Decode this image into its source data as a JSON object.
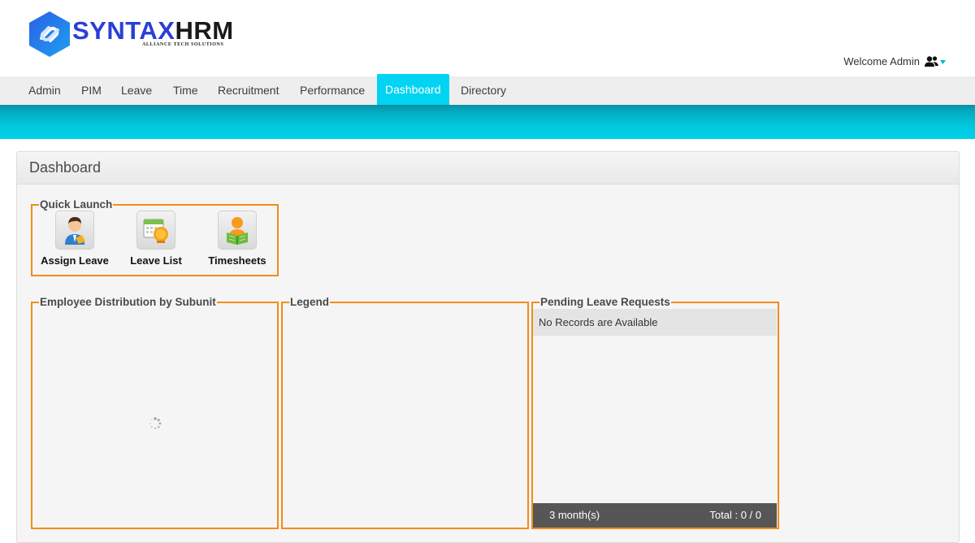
{
  "brand": {
    "name_part1": "SYNTAX",
    "name_part2": "HRM",
    "tagline": "ALLIANCE TECH SOLUTIONS",
    "colors": {
      "primary": "#2b3fd6",
      "logo_hex": "#2a7de1"
    }
  },
  "header": {
    "welcome_text": "Welcome Admin",
    "user_icon": "users-icon",
    "dropdown_icon": "caret-down-icon"
  },
  "nav": {
    "items": [
      {
        "label": "Admin"
      },
      {
        "label": "PIM"
      },
      {
        "label": "Leave"
      },
      {
        "label": "Time"
      },
      {
        "label": "Recruitment"
      },
      {
        "label": "Performance"
      },
      {
        "label": "Dashboard",
        "active": true
      },
      {
        "label": "Directory"
      }
    ],
    "active_color": "#00d4f2"
  },
  "dashboard": {
    "title": "Dashboard",
    "quick_launch": {
      "title": "Quick Launch",
      "items": [
        {
          "label": "Assign Leave",
          "icon": "assign-leave-icon"
        },
        {
          "label": "Leave List",
          "icon": "leave-list-icon"
        },
        {
          "label": "Timesheets",
          "icon": "timesheets-icon"
        }
      ]
    },
    "employee_distribution": {
      "title": "Employee Distribution by Subunit",
      "state": "loading"
    },
    "legend": {
      "title": "Legend"
    },
    "pending_leave": {
      "title": "Pending Leave Requests",
      "empty_text": "No Records are Available",
      "period": "3 month(s)",
      "total": "Total : 0 / 0"
    },
    "accent_color": "#f28c1a"
  }
}
